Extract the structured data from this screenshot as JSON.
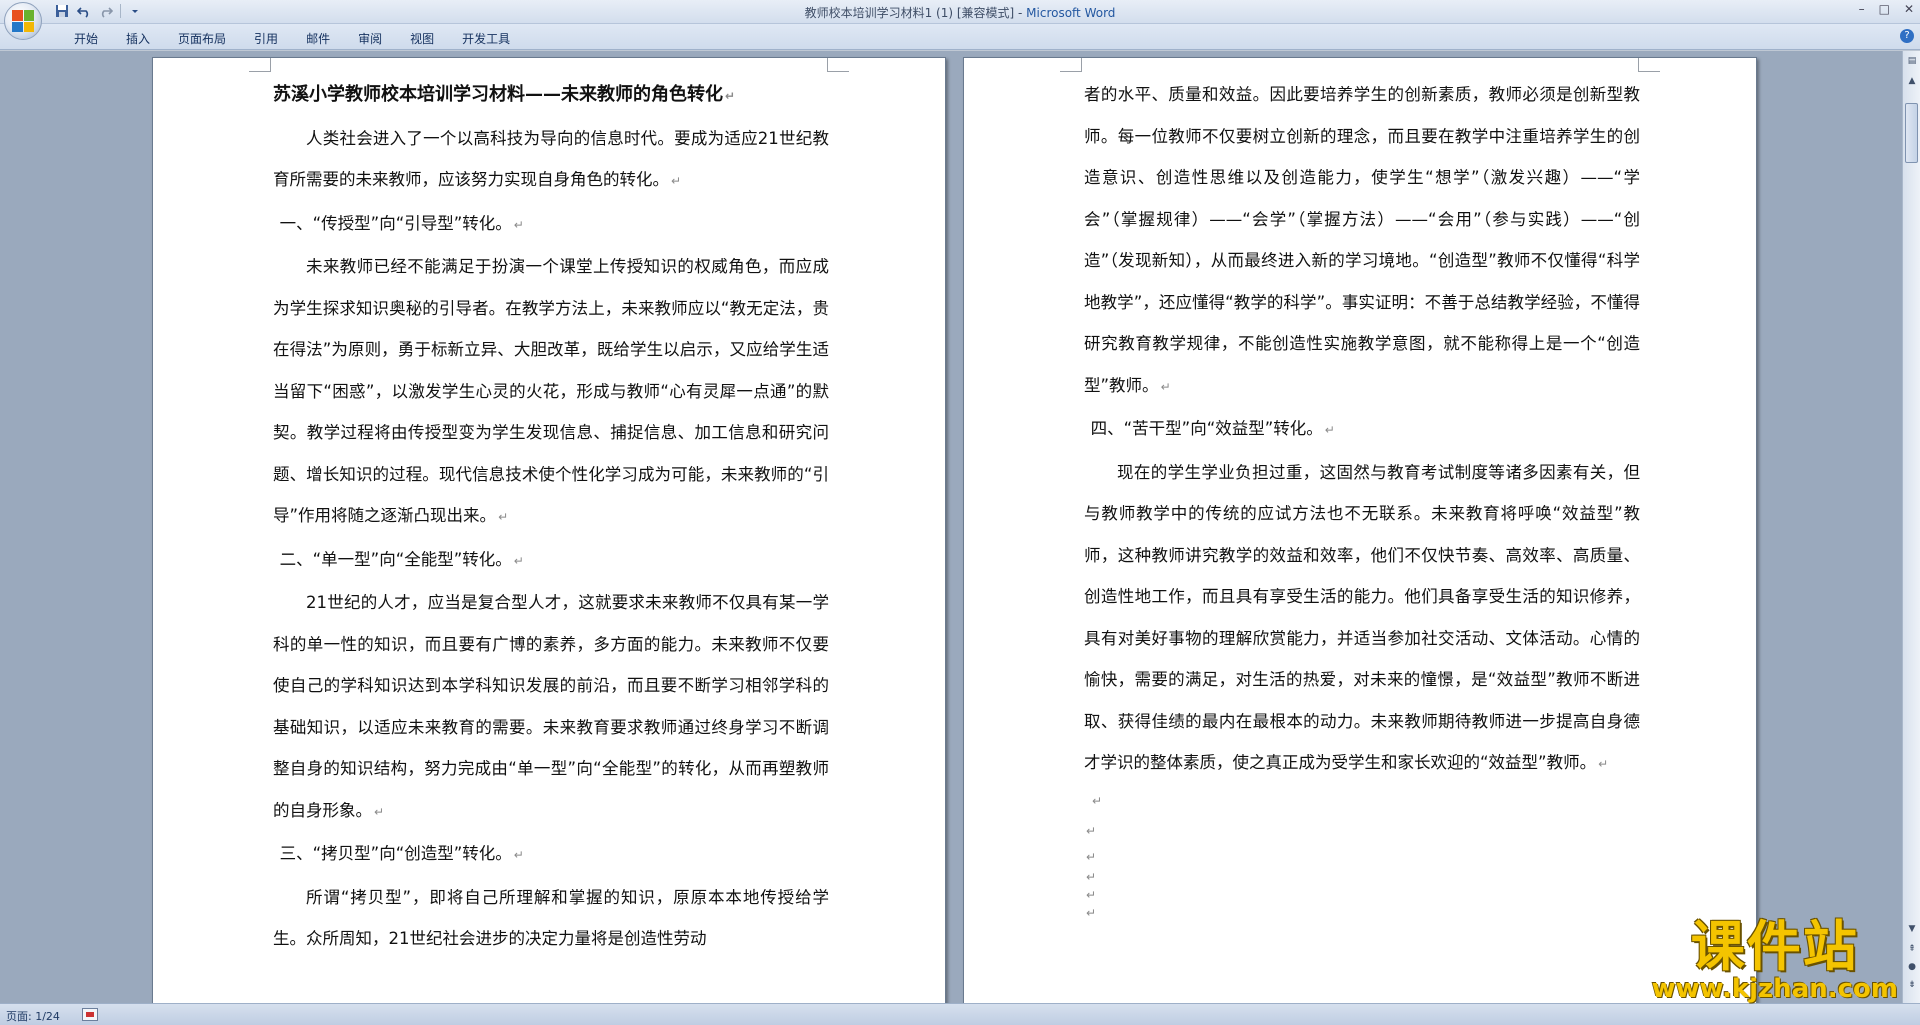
{
  "window": {
    "title_doc": "教师校本培训学习材料1 (1) [兼容模式] - ",
    "title_app": "Microsoft Word",
    "controls": [
      "–",
      "□",
      "✕"
    ]
  },
  "quick_access": {
    "save_icon": "save-icon",
    "undo_icon": "undo-icon",
    "redo_icon": "redo-icon"
  },
  "ribbon": {
    "tabs": [
      "开始",
      "插入",
      "页面布局",
      "引用",
      "邮件",
      "审阅",
      "视图",
      "开发工具"
    ],
    "help": "?"
  },
  "document": {
    "left_page": {
      "title": "苏溪小学教师校本培训学习材料——未来教师的角色转化",
      "paragraphs": [
        "人类社会进入了一个以高科技为导向的信息时代。要成为适应21世纪教育所需要的未来教师，应该努力实现自身角色的转化。",
        "一、“传授型”向“引导型”转化。",
        "未来教师已经不能满足于扮演一个课堂上传授知识的权威角色，而应成为学生探求知识奥秘的引导者。在教学方法上，未来教师应以“教无定法，贵在得法”为原则，勇于标新立异、大胆改革，既给学生以启示，又应给学生适当留下“困惑”，以激发学生心灵的火花，形成与教师“心有灵犀一点通”的默契。教学过程将由传授型变为学生发现信息、捕捉信息、加工信息和研究问题、增长知识的过程。现代信息技术使个性化学习成为可能，未来教师的“引导”作用将随之逐渐凸现出来。",
        "二、“单一型”向“全能型”转化。",
        "21世纪的人才，应当是复合型人才，这就要求未来教师不仅具有某一学科的单一性的知识，而且要有广博的素养，多方面的能力。未来教师不仅要使自己的学科知识达到本学科知识发展的前沿，而且要不断学习相邻学科的基础知识，以适应未来教育的需要。未来教育要求教师通过终身学习不断调整自身的知识结构，努力完成由“单一型”向“全能型”的转化，从而再塑教师的自身形象。",
        "三、“拷贝型”向“创造型”转化。",
        "所谓“拷贝型”，即将自己所理解和掌握的知识，原原本本地传授给学生。众所周知，21世纪社会进步的决定力量将是创造性劳动"
      ]
    },
    "right_page": {
      "paragraphs": [
        "者的水平、质量和效益。因此要培养学生的创新素质，教师必须是创新型教师。每一位教师不仅要树立创新的理念，而且要在教学中注重培养学生的创造意识、创造性思维以及创造能力，使学生“想学”（激发兴趣）——“学会”（掌握规律）——“会学”（掌握方法）——“会用”（参与实践）——“创造”（发现新知），从而最终进入新的学习境地。“创造型”教师不仅懂得“科学地教学”，还应懂得“教学的科学”。事实证明：不善于总结教学经验，不懂得研究教育教学规律，不能创造性实施教学意图，就不能称得上是一个“创造型”教师。",
        "四、“苦干型”向“效益型”转化。",
        "现在的学生学业负担过重，这固然与教育考试制度等诸多因素有关，但与教师教学中的传统的应试方法也不无联系。未来教育将呼唤“效益型”教师，这种教师讲究教学的效益和效率，他们不仅快节奏、高效率、高质量、创造性地工作，而且具有享受生活的能力。他们具备享受生活的知识修养，具有对美好事物的理解欣赏能力，并适当参加社交活动、文体活动。心情的愉快，需要的满足，对生活的热爱，对未来的憧憬，是“效益型”教师不断进取、获得佳绩的最内在最根本的动力。未来教师期待教师进一步提高自身德才学识的整体素质，使之真正成为受学生和家长欢迎的“效益型”教师。"
      ],
      "empty_marks": [
        "↵",
        "↵",
        "↵",
        "↵",
        "↵",
        "↵"
      ]
    },
    "paragraph_mark": "↵"
  },
  "status": {
    "page": "页面: 1/24"
  },
  "watermark": {
    "main": "课件站",
    "url": "www.kjzhan.com"
  },
  "colors": {
    "accent": "#2357a0",
    "watermark": "#f4c400",
    "workspace": "#9aa9bd"
  }
}
